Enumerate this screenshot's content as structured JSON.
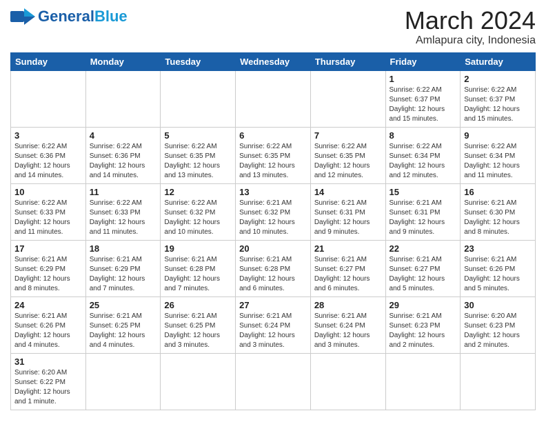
{
  "header": {
    "logo_general": "General",
    "logo_blue": "Blue",
    "month_title": "March 2024",
    "subtitle": "Amlapura city, Indonesia"
  },
  "weekdays": [
    "Sunday",
    "Monday",
    "Tuesday",
    "Wednesday",
    "Thursday",
    "Friday",
    "Saturday"
  ],
  "rows": [
    [
      {
        "day": "",
        "info": "",
        "empty": true
      },
      {
        "day": "",
        "info": "",
        "empty": true
      },
      {
        "day": "",
        "info": "",
        "empty": true
      },
      {
        "day": "",
        "info": "",
        "empty": true
      },
      {
        "day": "",
        "info": "",
        "empty": true
      },
      {
        "day": "1",
        "info": "Sunrise: 6:22 AM\nSunset: 6:37 PM\nDaylight: 12 hours\nand 15 minutes."
      },
      {
        "day": "2",
        "info": "Sunrise: 6:22 AM\nSunset: 6:37 PM\nDaylight: 12 hours\nand 15 minutes."
      }
    ],
    [
      {
        "day": "3",
        "info": "Sunrise: 6:22 AM\nSunset: 6:36 PM\nDaylight: 12 hours\nand 14 minutes."
      },
      {
        "day": "4",
        "info": "Sunrise: 6:22 AM\nSunset: 6:36 PM\nDaylight: 12 hours\nand 14 minutes."
      },
      {
        "day": "5",
        "info": "Sunrise: 6:22 AM\nSunset: 6:35 PM\nDaylight: 12 hours\nand 13 minutes."
      },
      {
        "day": "6",
        "info": "Sunrise: 6:22 AM\nSunset: 6:35 PM\nDaylight: 12 hours\nand 13 minutes."
      },
      {
        "day": "7",
        "info": "Sunrise: 6:22 AM\nSunset: 6:35 PM\nDaylight: 12 hours\nand 12 minutes."
      },
      {
        "day": "8",
        "info": "Sunrise: 6:22 AM\nSunset: 6:34 PM\nDaylight: 12 hours\nand 12 minutes."
      },
      {
        "day": "9",
        "info": "Sunrise: 6:22 AM\nSunset: 6:34 PM\nDaylight: 12 hours\nand 11 minutes."
      }
    ],
    [
      {
        "day": "10",
        "info": "Sunrise: 6:22 AM\nSunset: 6:33 PM\nDaylight: 12 hours\nand 11 minutes."
      },
      {
        "day": "11",
        "info": "Sunrise: 6:22 AM\nSunset: 6:33 PM\nDaylight: 12 hours\nand 11 minutes."
      },
      {
        "day": "12",
        "info": "Sunrise: 6:22 AM\nSunset: 6:32 PM\nDaylight: 12 hours\nand 10 minutes."
      },
      {
        "day": "13",
        "info": "Sunrise: 6:21 AM\nSunset: 6:32 PM\nDaylight: 12 hours\nand 10 minutes."
      },
      {
        "day": "14",
        "info": "Sunrise: 6:21 AM\nSunset: 6:31 PM\nDaylight: 12 hours\nand 9 minutes."
      },
      {
        "day": "15",
        "info": "Sunrise: 6:21 AM\nSunset: 6:31 PM\nDaylight: 12 hours\nand 9 minutes."
      },
      {
        "day": "16",
        "info": "Sunrise: 6:21 AM\nSunset: 6:30 PM\nDaylight: 12 hours\nand 8 minutes."
      }
    ],
    [
      {
        "day": "17",
        "info": "Sunrise: 6:21 AM\nSunset: 6:29 PM\nDaylight: 12 hours\nand 8 minutes."
      },
      {
        "day": "18",
        "info": "Sunrise: 6:21 AM\nSunset: 6:29 PM\nDaylight: 12 hours\nand 7 minutes."
      },
      {
        "day": "19",
        "info": "Sunrise: 6:21 AM\nSunset: 6:28 PM\nDaylight: 12 hours\nand 7 minutes."
      },
      {
        "day": "20",
        "info": "Sunrise: 6:21 AM\nSunset: 6:28 PM\nDaylight: 12 hours\nand 6 minutes."
      },
      {
        "day": "21",
        "info": "Sunrise: 6:21 AM\nSunset: 6:27 PM\nDaylight: 12 hours\nand 6 minutes."
      },
      {
        "day": "22",
        "info": "Sunrise: 6:21 AM\nSunset: 6:27 PM\nDaylight: 12 hours\nand 5 minutes."
      },
      {
        "day": "23",
        "info": "Sunrise: 6:21 AM\nSunset: 6:26 PM\nDaylight: 12 hours\nand 5 minutes."
      }
    ],
    [
      {
        "day": "24",
        "info": "Sunrise: 6:21 AM\nSunset: 6:26 PM\nDaylight: 12 hours\nand 4 minutes."
      },
      {
        "day": "25",
        "info": "Sunrise: 6:21 AM\nSunset: 6:25 PM\nDaylight: 12 hours\nand 4 minutes."
      },
      {
        "day": "26",
        "info": "Sunrise: 6:21 AM\nSunset: 6:25 PM\nDaylight: 12 hours\nand 3 minutes."
      },
      {
        "day": "27",
        "info": "Sunrise: 6:21 AM\nSunset: 6:24 PM\nDaylight: 12 hours\nand 3 minutes."
      },
      {
        "day": "28",
        "info": "Sunrise: 6:21 AM\nSunset: 6:24 PM\nDaylight: 12 hours\nand 3 minutes."
      },
      {
        "day": "29",
        "info": "Sunrise: 6:21 AM\nSunset: 6:23 PM\nDaylight: 12 hours\nand 2 minutes."
      },
      {
        "day": "30",
        "info": "Sunrise: 6:20 AM\nSunset: 6:23 PM\nDaylight: 12 hours\nand 2 minutes."
      }
    ],
    [
      {
        "day": "31",
        "info": "Sunrise: 6:20 AM\nSunset: 6:22 PM\nDaylight: 12 hours\nand 1 minute."
      },
      {
        "day": "",
        "info": "",
        "empty": true
      },
      {
        "day": "",
        "info": "",
        "empty": true
      },
      {
        "day": "",
        "info": "",
        "empty": true
      },
      {
        "day": "",
        "info": "",
        "empty": true
      },
      {
        "day": "",
        "info": "",
        "empty": true
      },
      {
        "day": "",
        "info": "",
        "empty": true
      }
    ]
  ]
}
